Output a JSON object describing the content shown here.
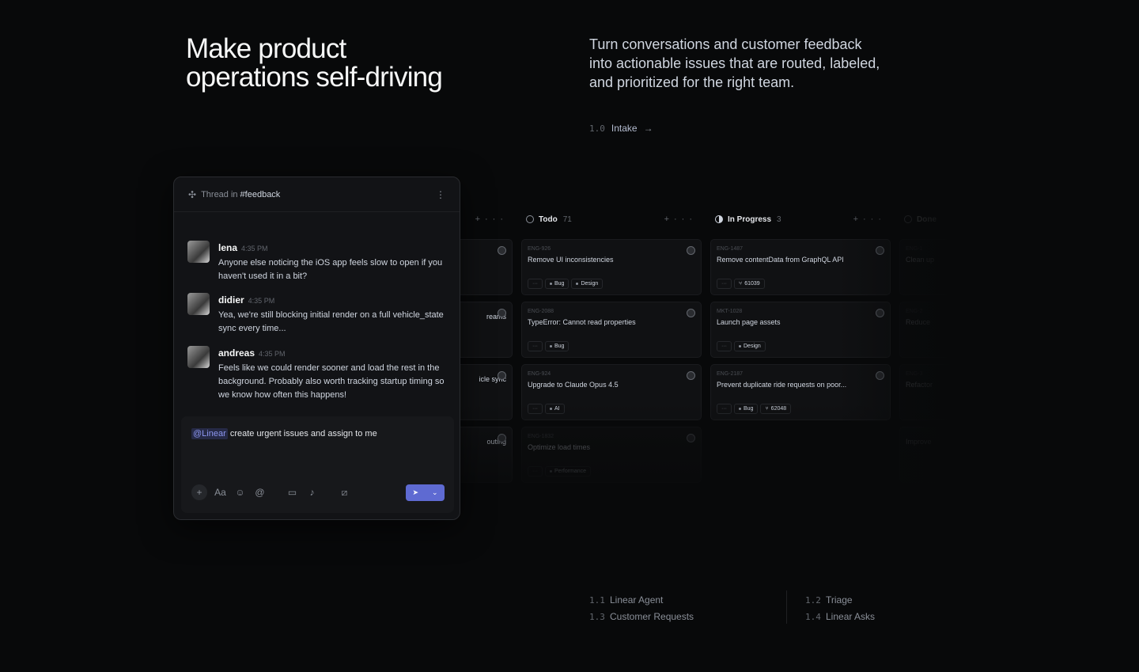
{
  "hero": {
    "title_line1": "Make product",
    "title_line2": "operations self-driving",
    "description": "Turn conversations and customer feedback into actionable issues that are routed, labeled, and prioritized for the right team."
  },
  "intake": {
    "num": "1.0",
    "label": "Intake",
    "arrow": "→"
  },
  "thread": {
    "prefix": "Thread in",
    "channel": "#feedback",
    "messages": [
      {
        "name": "lena",
        "time": "4:35 PM",
        "text": "Anyone else noticing the iOS app feels slow to open if you haven't used it in a bit?"
      },
      {
        "name": "didier",
        "time": "4:35 PM",
        "text": "Yea, we're still blocking initial render on a full vehicle_state sync every time..."
      },
      {
        "name": "andreas",
        "time": "4:35 PM",
        "text": "Feels like we could render sooner and load the rest in the background. Probably also worth tracking startup timing so we know how often this happens!"
      }
    ],
    "compose": {
      "mention": "@Linear",
      "text": "create urgent issues and assign to me"
    },
    "toolbar_aa": "Aa"
  },
  "board": {
    "columns": [
      {
        "title": "",
        "count": "",
        "cards": [
          {
            "id": "",
            "title": "",
            "tags": []
          },
          {
            "id": "",
            "title": "reams",
            "tags": []
          },
          {
            "id": "",
            "title": "icle sync",
            "tags": []
          },
          {
            "id": "",
            "title": "outing",
            "tags": []
          }
        ]
      },
      {
        "title": "Todo",
        "count": "71",
        "cards": [
          {
            "id": "ENG-926",
            "title": "Remove UI inconsistencies",
            "tags": [
              "Bug",
              "Design"
            ]
          },
          {
            "id": "ENG-2088",
            "title": "TypeError: Cannot read properties",
            "tags": [
              "Bug"
            ]
          },
          {
            "id": "ENG-924",
            "title": "Upgrade to Claude Opus 4.5",
            "tags": [
              "AI"
            ]
          },
          {
            "id": "ENG-1832",
            "title": "Optimize load times",
            "tags": [
              "Performance"
            ]
          }
        ]
      },
      {
        "title": "In Progress",
        "count": "3",
        "cards": [
          {
            "id": "ENG-1487",
            "title": "Remove contentData from GraphQL API",
            "tags": [
              "61039"
            ]
          },
          {
            "id": "MKT-1028",
            "title": "Launch page assets",
            "tags": [
              "Design"
            ]
          },
          {
            "id": "ENG-2187",
            "title": "Prevent duplicate ride requests on poor...",
            "tags": [
              "Bug",
              "62048"
            ]
          }
        ]
      },
      {
        "title": "Done",
        "count": "",
        "cards": [
          {
            "id": "ENG-1",
            "title": "Clean up",
            "tags": []
          },
          {
            "id": "ENG-2",
            "title": "Reduce",
            "tags": []
          },
          {
            "id": "ENG-3",
            "title": "Refactor",
            "tags": []
          },
          {
            "id": "",
            "title": "Improve",
            "tags": []
          }
        ]
      }
    ]
  },
  "sublinks": [
    {
      "num": "1.1",
      "label": "Linear Agent"
    },
    {
      "num": "1.3",
      "label": "Customer Requests"
    },
    {
      "num": "1.2",
      "label": "Triage"
    },
    {
      "num": "1.4",
      "label": "Linear Asks"
    }
  ]
}
